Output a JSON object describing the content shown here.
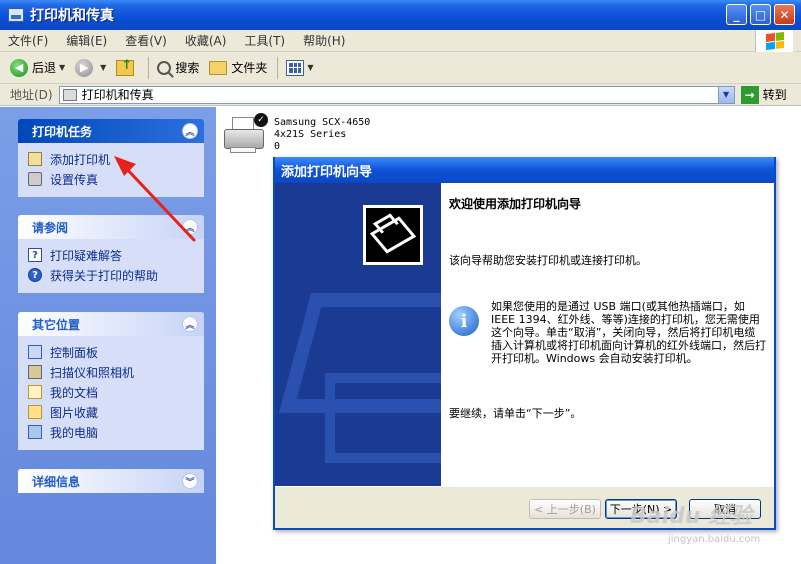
{
  "window": {
    "title": "打印机和传真",
    "buttons": {
      "minimize": "_",
      "maximize": "□",
      "close": "✕"
    }
  },
  "menu": [
    "文件(F)",
    "编辑(E)",
    "查看(V)",
    "收藏(A)",
    "工具(T)",
    "帮助(H)"
  ],
  "toolbar": {
    "back": "后退",
    "search": "搜索",
    "folders": "文件夹"
  },
  "address": {
    "label": "地址(D)",
    "value": "打印机和传真",
    "go": "转到"
  },
  "left": {
    "tasks": {
      "title": "打印机任务",
      "items": [
        "添加打印机",
        "设置传真"
      ]
    },
    "see_also": {
      "title": "请参阅",
      "items": [
        "打印疑难解答",
        "获得关于打印的帮助"
      ]
    },
    "other": {
      "title": "其它位置",
      "items": [
        "控制面板",
        "扫描仪和照相机",
        "我的文档",
        "图片收藏",
        "我的电脑"
      ]
    },
    "details": {
      "title": "详细信息"
    }
  },
  "printer": {
    "name": "Samsung SCX-4650",
    "model": "4x21S Series",
    "count": "0"
  },
  "wizard": {
    "title": "添加打印机向导",
    "heading": "欢迎使用添加打印机向导",
    "intro": "该向导帮助您安装打印机或连接打印机。",
    "info": "如果您使用的是通过 USB 端口(或其他热插端口，如 IEEE 1394、红外线、等等)连接的打印机，您无需使用这个向导。单击“取消”，关闭向导，然后将打印机电缆插入计算机或将打印机面向计算机的红外线端口，然后打开打印机。Windows 会自动安装打印机。",
    "continue": "要继续，请单击“下一步”。",
    "buttons": {
      "back": "< 上一步(B)",
      "next": "下一步(N) >",
      "cancel": "取消"
    }
  },
  "watermark": {
    "main": "Baidu 经验",
    "sub": "jingyan.baidu.com"
  }
}
